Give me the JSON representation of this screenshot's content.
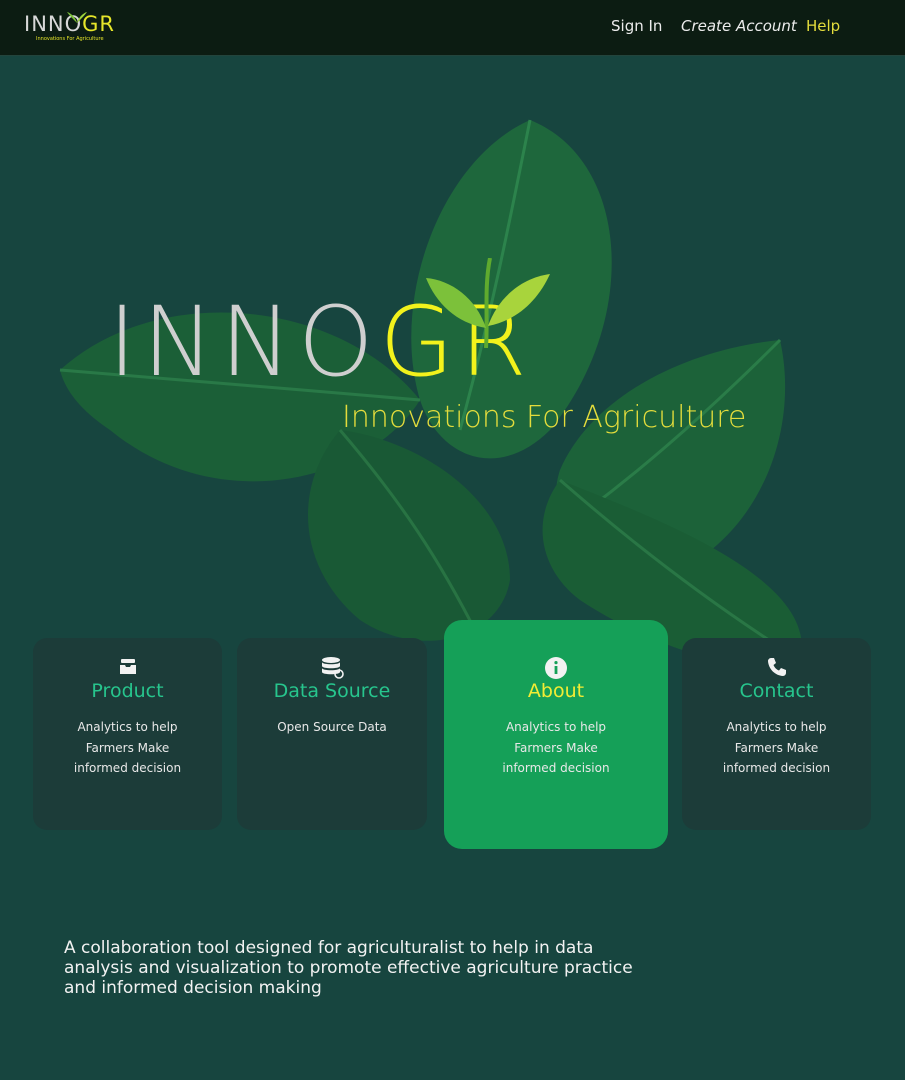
{
  "header": {
    "logo": {
      "brand_prefix": "INNO",
      "brand_suffix": "GR",
      "tagline": "Innovations For Agriculture"
    },
    "nav": {
      "sign_in": "Sign In",
      "create_account": "Create Account",
      "help": "Help"
    }
  },
  "hero": {
    "brand_prefix": "INNO",
    "brand_suffix": "GR",
    "tagline": "Innovations For Agriculture"
  },
  "cards": [
    {
      "title": "Product",
      "icon": "inbox-tray-icon",
      "desc": [
        "Analytics to help",
        "Farmers Make",
        "informed decision"
      ]
    },
    {
      "title": "Data Source",
      "icon": "database-refresh-icon",
      "desc": [
        "Open Source Data"
      ]
    },
    {
      "title": "About",
      "icon": "info-icon",
      "desc": [
        "Analytics to help",
        "Farmers Make",
        "informed decision"
      ],
      "active": true
    },
    {
      "title": "Contact",
      "icon": "phone-icon",
      "desc": [
        "Analytics to help",
        "Farmers Make",
        "informed decision"
      ]
    }
  ],
  "description": "A collaboration tool designed for agriculturalist to help in  data analysis and visualization to promote effective agriculture practice and informed decision making",
  "colors": {
    "background": "#17453f",
    "navbar": "#0c1c12",
    "card": "#1c3c39",
    "card_active": "#15a058",
    "accent_yellow": "#f2f21c",
    "accent_green": "#27c58d"
  }
}
